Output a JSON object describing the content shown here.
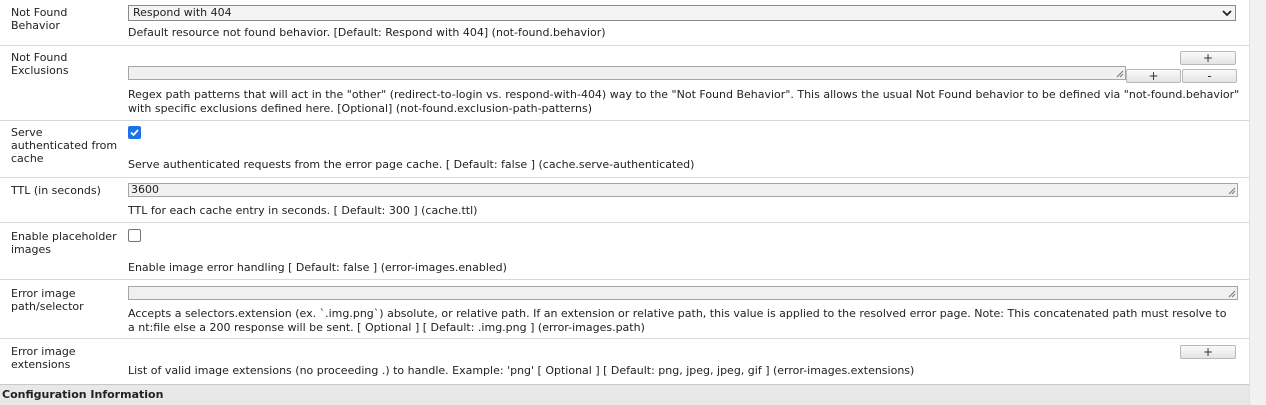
{
  "rows": {
    "not_found_behavior": {
      "label": "Not Found Behavior",
      "select_value": "Respond with 404",
      "description": "Default resource not found behavior. [Default: Respond with 404] (not-found.behavior)"
    },
    "not_found_exclusions": {
      "label": "Not Found Exclusions",
      "value": "",
      "add_label": "+",
      "remove_label": "-",
      "description": "Regex path patterns that will act in the \"other\" (redirect-to-login vs.  respond-with-404) way to the \"Not Found Behavior\". This allows the usual Not Found behavior to be defined via \"not-found.behavior\" with specific exclusions defined here. [Optional] (not-found.exclusion-path-patterns)"
    },
    "serve_authenticated": {
      "label": "Serve authenticated from cache",
      "checked": true,
      "description": "Serve authenticated requests from the error page cache. [ Default: false ] (cache.serve-authenticated)"
    },
    "ttl": {
      "label": "TTL (in seconds)",
      "value": "3600",
      "description": "TTL for each cache entry in seconds. [ Default: 300 ] (cache.ttl)"
    },
    "enable_placeholder": {
      "label": "Enable placeholder images",
      "checked": false,
      "description": "Enable image error handling  [ Default: false ] (error-images.enabled)"
    },
    "error_image_path": {
      "label": "Error image path/selector",
      "value": "",
      "description": "Accepts a selectors.extension (ex. `.img.png`) absolute, or relative path. If an extension or relative path, this value is applied to the resolved error page. Note: This concatenated path must resolve to a nt:file else a 200 response will be sent. [ Optional ] [ Default: .img.png ] (error-images.path)"
    },
    "error_image_extensions": {
      "label": "Error image extensions",
      "add_label": "+",
      "description": "List of valid image extensions (no proceeding .) to handle. Example: 'png' [ Optional ] [ Default: png, jpeg, jpeg, gif ] (error-images.extensions)"
    }
  },
  "footer": {
    "title": "Configuration Information"
  },
  "colors": {
    "checkbox_checked": "#1a73e8",
    "footer_bg": "#e8e8e8"
  }
}
